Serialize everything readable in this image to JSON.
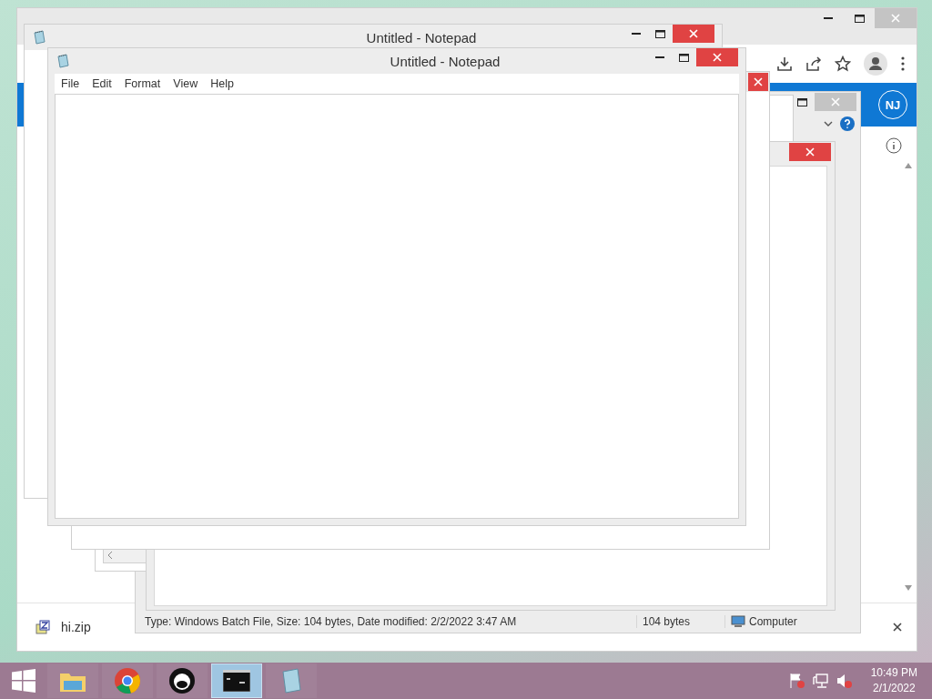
{
  "browser": {
    "avatar": "NJ",
    "download": {
      "file_name": "hi.zip"
    }
  },
  "explorer": {
    "status_bar": [
      "Type: Windows Batch File, Size: 104 bytes, Date modified: 2/2/2022 3:47 AM",
      "104 bytes",
      "Computer"
    ]
  },
  "notepads": [
    {
      "title": "Untitled - Notepad"
    },
    {
      "title": "Untitled - Notepad",
      "menu": [
        "File",
        "Edit",
        "Format",
        "View",
        "Help"
      ]
    }
  ],
  "taskbar": {
    "apps": [
      {
        "kind": "explorer",
        "selected": false
      },
      {
        "kind": "chrome",
        "selected": false
      },
      {
        "kind": "app",
        "selected": false
      },
      {
        "kind": "cmd",
        "selected": true
      },
      {
        "kind": "notepad",
        "selected": false
      }
    ],
    "tray": {
      "time": "10:49 PM",
      "date": "2/1/2022"
    }
  }
}
